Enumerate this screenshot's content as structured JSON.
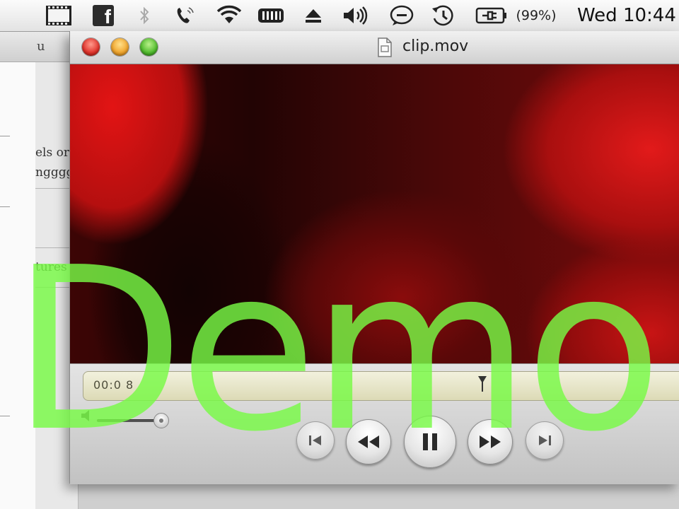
{
  "menubar": {
    "icons": [
      "clapperboard-icon",
      "facebook-icon",
      "bluetooth-icon",
      "phone-icon",
      "wifi-icon",
      "battery-bar-icon",
      "eject-icon",
      "volume-icon",
      "chat-icon",
      "time-machine-icon",
      "power-plug-icon"
    ],
    "facebook_glyph": "f",
    "battery_percent": "(99%)",
    "clock": "Wed 10:44"
  },
  "background_window": {
    "title_fragment": "u",
    "lines": [
      "els or",
      "ngggg",
      "tures"
    ]
  },
  "movie_window": {
    "title": "clip.mov",
    "time_display": "00:0 8",
    "playhead_position_fraction": 0.67,
    "volume_level_fraction": 1.0
  },
  "watermark": "Demo",
  "colors": {
    "watermark": "#78fa46",
    "video_red": "#d01010"
  }
}
